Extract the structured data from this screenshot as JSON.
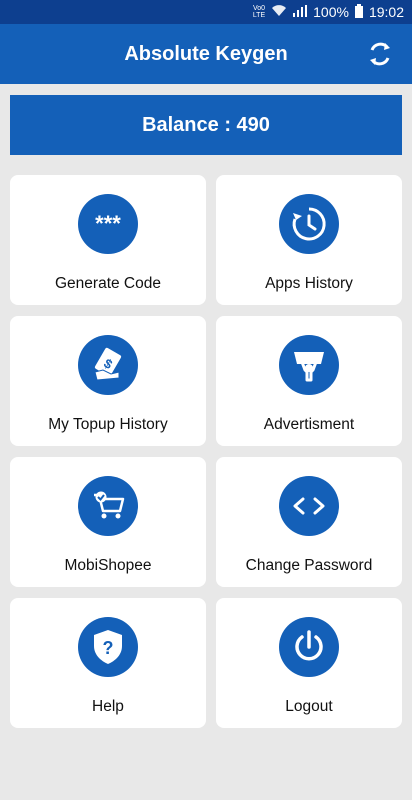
{
  "status_bar": {
    "volte": "Vo0 LTE",
    "battery_percent": "100%",
    "time": "19:02",
    "icons": [
      "volte-icon",
      "wifi-icon",
      "signal-icon",
      "battery-icon"
    ]
  },
  "app_bar": {
    "title": "Absolute Keygen",
    "action_icon": "refresh-icon"
  },
  "balance": {
    "text": "Balance : 490"
  },
  "menu": [
    {
      "label": "Generate Code",
      "icon": "asterisks-icon"
    },
    {
      "label": "Apps History",
      "icon": "history-clock-icon"
    },
    {
      "label": "My Topup History",
      "icon": "money-hand-icon"
    },
    {
      "label": "Advertisment",
      "icon": "banner-person-icon"
    },
    {
      "label": "MobiShopee",
      "icon": "shopping-cart-icon"
    },
    {
      "label": "Change Password",
      "icon": "code-brackets-icon"
    },
    {
      "label": "Help",
      "icon": "shield-question-icon"
    },
    {
      "label": "Logout",
      "icon": "power-icon"
    }
  ],
  "colors": {
    "primary": "#1460b8",
    "status_bar": "#0d3f8f",
    "background": "#e8e8e8",
    "card": "#ffffff"
  }
}
